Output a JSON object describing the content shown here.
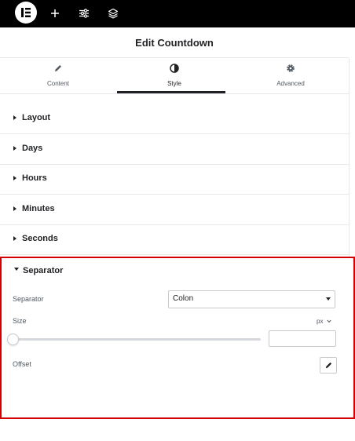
{
  "topbar": {
    "icons": [
      "elementor-logo-icon",
      "plus-icon",
      "sliders-icon",
      "layers-icon"
    ]
  },
  "panel": {
    "title": "Edit Countdown"
  },
  "tabs": [
    {
      "label": "Content",
      "icon": "pencil-icon",
      "active": false
    },
    {
      "label": "Style",
      "icon": "contrast-icon",
      "active": true
    },
    {
      "label": "Advanced",
      "icon": "gear-icon",
      "active": false
    }
  ],
  "sections": [
    {
      "label": "Layout"
    },
    {
      "label": "Days"
    },
    {
      "label": "Hours"
    },
    {
      "label": "Minutes"
    },
    {
      "label": "Seconds"
    }
  ],
  "separator_section": {
    "label": "Separator",
    "separator_field": {
      "label": "Separator",
      "value": "Colon"
    },
    "size_field": {
      "label": "Size",
      "unit": "px",
      "value": ""
    },
    "offset_field": {
      "label": "Offset"
    }
  },
  "colors": {
    "topbar_bg": "#000000",
    "highlight_border": "#d40000",
    "text_dark": "#1f2124",
    "text_muted": "#515962"
  }
}
